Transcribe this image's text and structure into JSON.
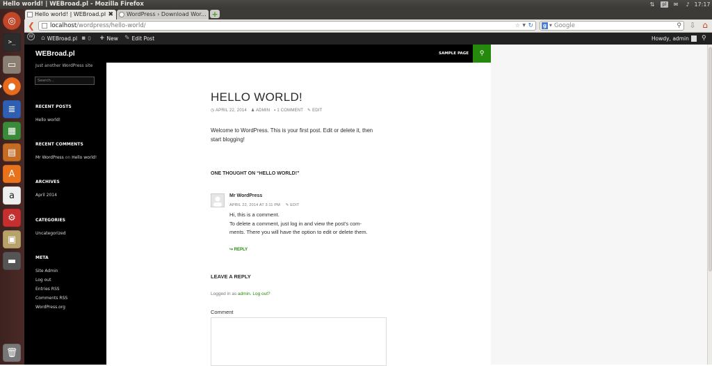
{
  "window": {
    "title": "Hello world! | WEBroad.pl - Mozilla Firefox"
  },
  "system_tray": {
    "clock": "17:17",
    "keyboard": "pl"
  },
  "tabs": [
    {
      "label": "Hello world! | WEBroad.pl",
      "active": true
    },
    {
      "label": "WordPress › Download Wor...",
      "active": false
    }
  ],
  "address_bar": {
    "host": "localhost",
    "path": "/wordpress/hello-world/"
  },
  "search_bar": {
    "engine": "g",
    "placeholder": "Google"
  },
  "admin_bar": {
    "site_name": "WEBroad.pl",
    "new_label": "New",
    "edit_label": "Edit Post",
    "howdy": "Howdy, admin"
  },
  "site": {
    "title": "WEBroad.pl",
    "tagline": "Just another WordPress site",
    "search_placeholder": "Search..."
  },
  "header_menu": {
    "sample_page": "SAMPLE PAGE"
  },
  "sidebar": {
    "recent_posts": {
      "heading": "RECENT POSTS",
      "items": [
        "Hello world!"
      ]
    },
    "recent_comments": {
      "heading": "RECENT COMMENTS",
      "author": "Mr WordPress",
      "on": "on",
      "post": "Hello world!"
    },
    "archives": {
      "heading": "ARCHIVES",
      "items": [
        "April 2014"
      ]
    },
    "categories": {
      "heading": "CATEGORIES",
      "items": [
        "Uncategorized"
      ]
    },
    "meta": {
      "heading": "META",
      "items": [
        "Site Admin",
        "Log out",
        "Entries RSS",
        "Comments RSS",
        "WordPress.org"
      ]
    }
  },
  "post": {
    "title": "HELLO WORLD!",
    "date": "APRIL 22, 2014",
    "author": "ADMIN",
    "comments": "1 COMMENT",
    "edit": "EDIT",
    "body_line1": "Welcome to WordPress. This is your first post. Edit or delete it, then",
    "body_line2": "start blogging!"
  },
  "comments": {
    "heading": "ONE THOUGHT ON “HELLO WORLD!”",
    "author": "Mr WordPress",
    "date": "APRIL 22, 2014 AT 3:11 PM",
    "edit": "EDIT",
    "line1": "Hi, this is a comment.",
    "line2": "To delete a comment, just log in and view the post's com-",
    "line3": "ments. There you will have the option to edit or delete them.",
    "reply": "REPLY"
  },
  "reply_form": {
    "heading": "LEAVE A REPLY",
    "logged_in_as": "Logged in as",
    "user": "admin.",
    "logout": "Log out?",
    "comment_label": "Comment"
  }
}
